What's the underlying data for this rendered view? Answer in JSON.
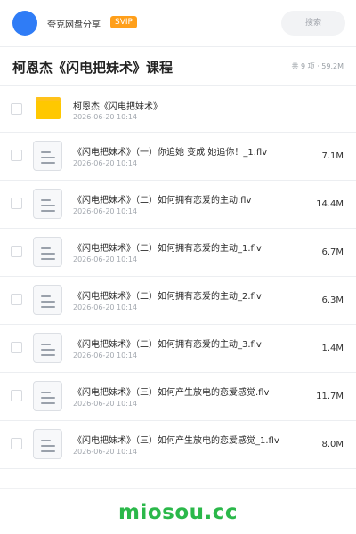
{
  "header": {
    "app_name": "夸克网盘分享",
    "badge": "SVIP",
    "search_placeholder": "搜索"
  },
  "page": {
    "title": "柯恩杰《闪电把妹术》课程",
    "meta": "共 9 项 · 59.2M"
  },
  "items": [
    {
      "type": "folder",
      "name": "柯恩杰《闪电把妹术》",
      "date": "2026-06-20 10:14",
      "size": ""
    },
    {
      "type": "file",
      "name": "《闪电把妹术》（一）你追她 变成 她追你！_1.flv",
      "date": "2026-06-20 10:14",
      "size": "7.1M"
    },
    {
      "type": "file",
      "name": "《闪电把妹术》（二）如何拥有恋爱的主动.flv",
      "date": "2026-06-20 10:14",
      "size": "14.4M"
    },
    {
      "type": "file",
      "name": "《闪电把妹术》（二）如何拥有恋爱的主动_1.flv",
      "date": "2026-06-20 10:14",
      "size": "6.7M"
    },
    {
      "type": "file",
      "name": "《闪电把妹术》（二）如何拥有恋爱的主动_2.flv",
      "date": "2026-06-20 10:14",
      "size": "6.3M"
    },
    {
      "type": "file",
      "name": "《闪电把妹术》（二）如何拥有恋爱的主动_3.flv",
      "date": "2026-06-20 10:14",
      "size": "1.4M"
    },
    {
      "type": "file",
      "name": "《闪电把妹术》（三）如何产生放电的恋爱感觉.flv",
      "date": "2026-06-20 10:14",
      "size": "11.7M"
    },
    {
      "type": "file",
      "name": "《闪电把妹术》（三）如何产生放电的恋爱感觉_1.flv",
      "date": "2026-06-20 10:14",
      "size": "8.0M"
    }
  ],
  "watermark": "miosou.cc",
  "colors": {
    "avatar": "#2f7cf6",
    "svip_badge": "#ff9f1a",
    "folder": "#ffc800",
    "watermark": "#2bb84a"
  },
  "icons": {
    "folder": "folder-icon",
    "file": "document-icon"
  }
}
